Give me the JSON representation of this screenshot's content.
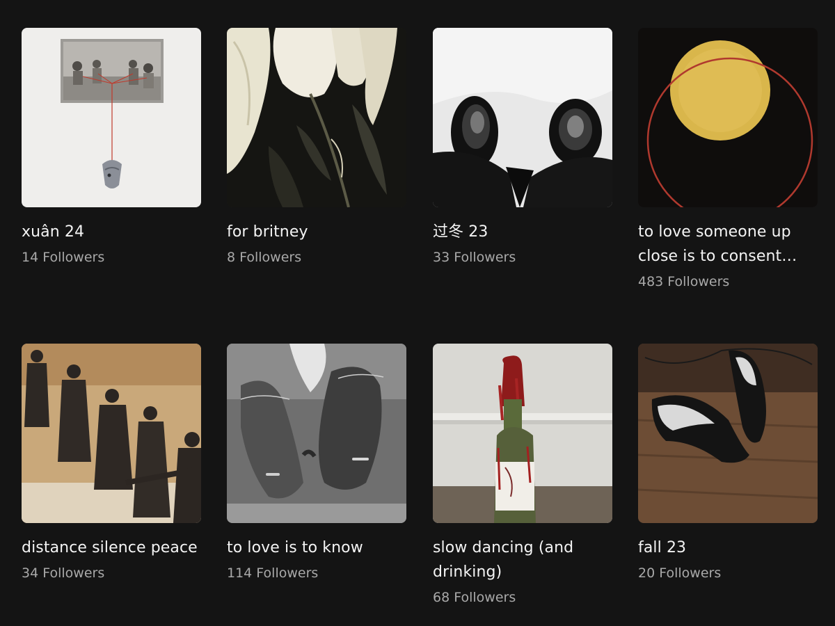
{
  "playlists": [
    {
      "title": "xuân 24",
      "followers": "14 Followers",
      "image": "vintage-photo-fish-collage"
    },
    {
      "title": "for britney",
      "followers": "8 Followers",
      "image": "white-lilies"
    },
    {
      "title": "过冬 23",
      "followers": "33 Followers",
      "image": "black-shoes-in-snow"
    },
    {
      "title": "to love someone up close is to consent…",
      "followers": "483 Followers",
      "image": "yellow-circle-red-ring"
    },
    {
      "title": "distance silence peace",
      "followers": "34 Followers",
      "image": "dancers-silhouettes"
    },
    {
      "title": "to love is to know",
      "followers": "114 Followers",
      "image": "holding-hands"
    },
    {
      "title": "slow dancing (and drinking)",
      "followers": "68 Followers",
      "image": "wine-bottle-candle"
    },
    {
      "title": "fall 23",
      "followers": "20 Followers",
      "image": "black-heels-on-wood"
    }
  ]
}
